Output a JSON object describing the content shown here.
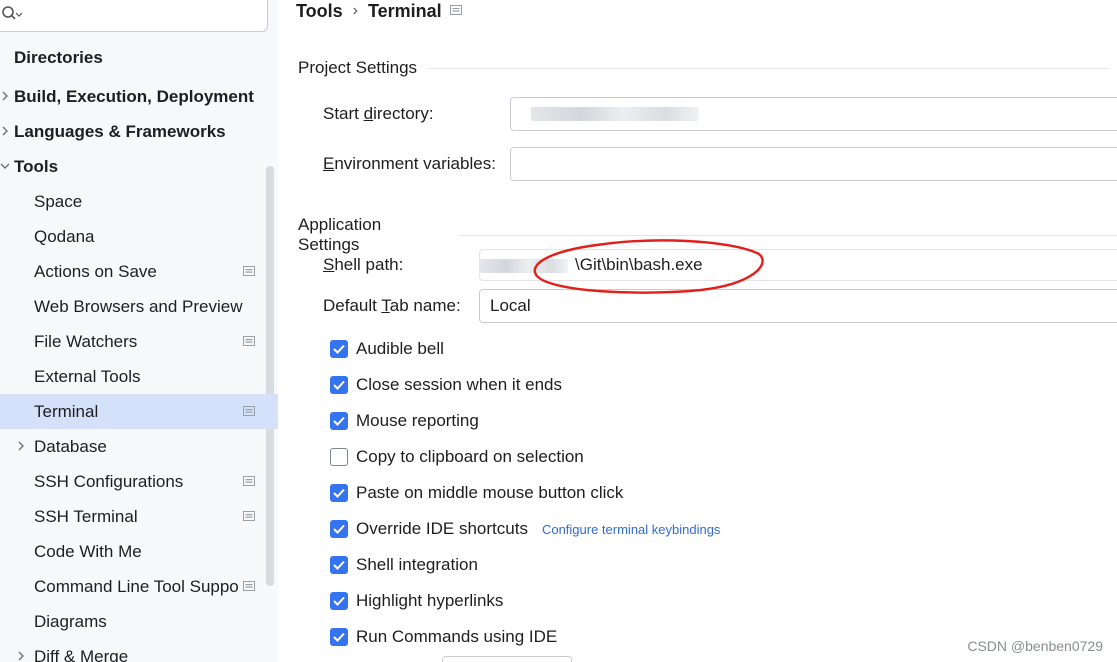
{
  "search": {
    "placeholder": ""
  },
  "sidebar": {
    "items": [
      {
        "label": "Directories",
        "bold": true
      },
      {
        "label": "Build, Execution, Deployment",
        "bold": true,
        "chevron": "right"
      },
      {
        "label": "Languages & Frameworks",
        "bold": true,
        "chevron": "right"
      },
      {
        "label": "Tools",
        "bold": true,
        "chevron": "down"
      },
      {
        "label": "Space"
      },
      {
        "label": "Qodana"
      },
      {
        "label": "Actions on Save",
        "project_icon": true
      },
      {
        "label": "Web Browsers and Preview"
      },
      {
        "label": "File Watchers",
        "project_icon": true
      },
      {
        "label": "External Tools"
      },
      {
        "label": "Terminal",
        "project_icon": true,
        "selected": true
      },
      {
        "label": "Database",
        "chevron": "right"
      },
      {
        "label": "SSH Configurations",
        "project_icon": true
      },
      {
        "label": "SSH Terminal",
        "project_icon": true
      },
      {
        "label": "Code With Me"
      },
      {
        "label": "Command Line Tool Support",
        "project_icon": true
      },
      {
        "label": "Diagrams"
      },
      {
        "label": "Diff & Merge",
        "chevron": "right"
      }
    ]
  },
  "breadcrumb": {
    "parent": "Tools",
    "separator": "›",
    "current": "Terminal"
  },
  "project_settings": {
    "title": "Project Settings",
    "start_directory_label_pre": "Start ",
    "start_directory_label_mnemonic": "d",
    "start_directory_label_post": "irectory:",
    "start_directory_value": "",
    "env_label_mnemonic": "E",
    "env_label_post": "nvironment variables:",
    "env_value": ""
  },
  "app_settings": {
    "title": "Application Settings",
    "shell_label_mnemonic": "S",
    "shell_label_post": "hell path:",
    "shell_path_value": "\\Git\\bin\\bash.exe",
    "tab_label_pre": "Default ",
    "tab_label_mnemonic": "T",
    "tab_label_post": "ab name:",
    "tab_name_value": "Local",
    "checkboxes": [
      {
        "label": "Audible bell",
        "checked": true
      },
      {
        "label": "Close session when it ends",
        "checked": true
      },
      {
        "label": "Mouse reporting",
        "checked": true
      },
      {
        "label": "Copy to clipboard on selection",
        "checked": false
      },
      {
        "label": "Paste on middle mouse button click",
        "checked": true
      },
      {
        "label": "Override IDE shortcuts",
        "checked": true,
        "link": "Configure terminal keybindings"
      },
      {
        "label": "Shell integration",
        "checked": true
      },
      {
        "label": "Highlight hyperlinks",
        "checked": true
      },
      {
        "label": "Run Commands using IDE",
        "checked": true
      }
    ]
  },
  "watermark": "CSDN @benben0729",
  "colors": {
    "accent": "#3574f0",
    "selection": "#d5e1fb",
    "annotation": "#e0201b",
    "link": "#2f6bd9"
  },
  "icons": [
    "search-icon",
    "chevron-right-icon",
    "chevron-down-icon",
    "project-scope-icon",
    "checkmark-icon"
  ]
}
